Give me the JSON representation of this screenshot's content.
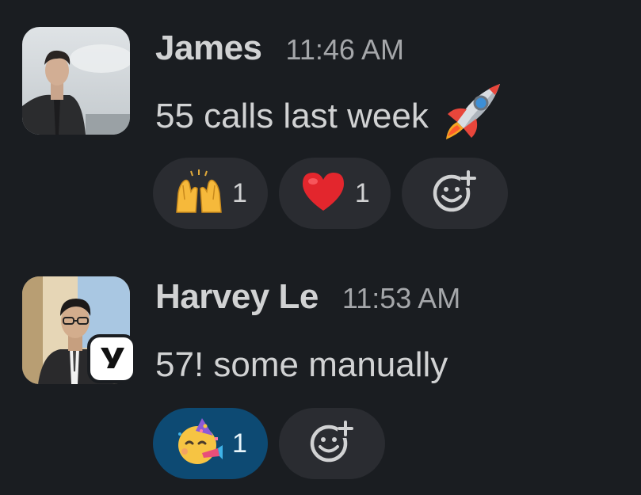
{
  "messages": [
    {
      "sender": "James",
      "timestamp": "11:46 AM",
      "text": "55 calls last week",
      "inline_emoji": "rocket-icon",
      "reactions": [
        {
          "icon": "raised-hands-icon",
          "count": "1",
          "active": false
        },
        {
          "icon": "red-heart-icon",
          "count": "1",
          "active": false
        }
      ],
      "add_reaction_icon": "add-emoji-icon"
    },
    {
      "sender": "Harvey Le",
      "timestamp": "11:53 AM",
      "text": "57! some manually",
      "app_badge": "y",
      "reactions": [
        {
          "icon": "partying-face-icon",
          "count": "1",
          "active": true
        }
      ],
      "add_reaction_icon": "add-emoji-icon"
    }
  ],
  "colors": {
    "background": "#1a1d21",
    "text": "#d1d2d3",
    "timestamp": "#a5a7aa",
    "reaction_bg": "#2a2c31",
    "reaction_active_bg": "#0d4a73"
  }
}
